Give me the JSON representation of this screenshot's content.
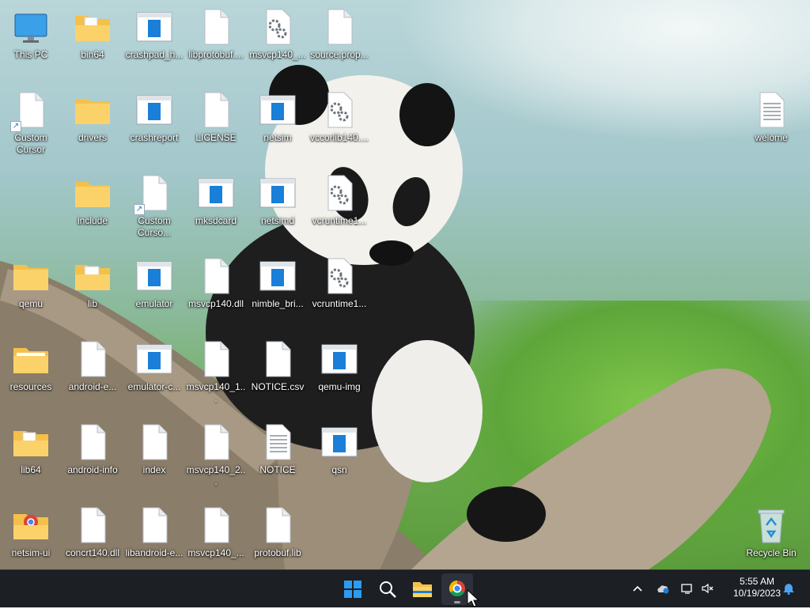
{
  "desktop": {
    "icons": [
      {
        "label": "This PC",
        "kind": "monitor-icon"
      },
      {
        "label": "bin64",
        "kind": "folder-icon"
      },
      {
        "label": "crashpad_h...",
        "kind": "app-icon"
      },
      {
        "label": "libprotobuf....",
        "kind": "file-icon"
      },
      {
        "label": "msvcp140_...",
        "kind": "dll-gear-icon"
      },
      {
        "label": "source.prop...",
        "kind": "file-icon"
      },
      {
        "label": "Custom Cursor",
        "kind": "shortcut-file-icon"
      },
      {
        "label": "drivers",
        "kind": "folder-icon"
      },
      {
        "label": "crashreport",
        "kind": "app-icon"
      },
      {
        "label": "LICENSE",
        "kind": "file-icon"
      },
      {
        "label": "netsim",
        "kind": "app-icon"
      },
      {
        "label": "vccorlib140....",
        "kind": "dll-gear-icon"
      },
      {
        "label": "welome",
        "kind": "text-file-icon"
      },
      {
        "label": "include",
        "kind": "folder-icon"
      },
      {
        "label": "Custom Curso...",
        "kind": "shortcut-file-icon"
      },
      {
        "label": "mksdcard",
        "kind": "app-icon"
      },
      {
        "label": "netsimd",
        "kind": "app-icon"
      },
      {
        "label": "vcruntime1...",
        "kind": "dll-gear-icon"
      },
      {
        "label": "qemu",
        "kind": "folder-icon"
      },
      {
        "label": "lib",
        "kind": "folder-icon"
      },
      {
        "label": "emulator",
        "kind": "app-icon"
      },
      {
        "label": "msvcp140.dll",
        "kind": "file-icon"
      },
      {
        "label": "nimble_bri...",
        "kind": "app-icon"
      },
      {
        "label": "vcruntime1...",
        "kind": "dll-gear-icon"
      },
      {
        "label": "resources",
        "kind": "folder-icon"
      },
      {
        "label": "android-e...",
        "kind": "file-icon"
      },
      {
        "label": "emulator-c...",
        "kind": "app-icon"
      },
      {
        "label": "msvcp140_1...",
        "kind": "file-icon"
      },
      {
        "label": "NOTICE.csv",
        "kind": "file-icon"
      },
      {
        "label": "qemu-img",
        "kind": "app-icon"
      },
      {
        "label": "lib64",
        "kind": "folder-icon"
      },
      {
        "label": "android-info",
        "kind": "file-icon"
      },
      {
        "label": "index",
        "kind": "file-icon"
      },
      {
        "label": "msvcp140_2...",
        "kind": "file-icon"
      },
      {
        "label": "NOTICE",
        "kind": "text-file-icon"
      },
      {
        "label": "qsn",
        "kind": "app-icon"
      },
      {
        "label": "netsim-ui",
        "kind": "chrome-folder-icon"
      },
      {
        "label": "concrt140.dll",
        "kind": "file-icon"
      },
      {
        "label": "libandroid-e...",
        "kind": "file-icon"
      },
      {
        "label": "msvcp140_...",
        "kind": "file-icon"
      },
      {
        "label": "protobuf.lib",
        "kind": "file-icon"
      },
      {
        "label": "Recycle Bin",
        "kind": "recycle-bin-icon"
      }
    ]
  },
  "taskbar": {
    "apps": [
      "start-icon",
      "search-icon",
      "file-explorer-icon",
      "chrome-icon"
    ],
    "active_app": "chrome-icon",
    "tray": [
      "chevron-up-icon",
      "onedrive-icon",
      "network-icon",
      "volume-muted-icon"
    ],
    "time": "5:55 AM",
    "date": "10/19/2023",
    "notification_icon": "bell-icon"
  },
  "colors": {
    "taskbar_bg": "#1c1f24",
    "folder": "#f5c04a",
    "accent": "#0078d4"
  }
}
